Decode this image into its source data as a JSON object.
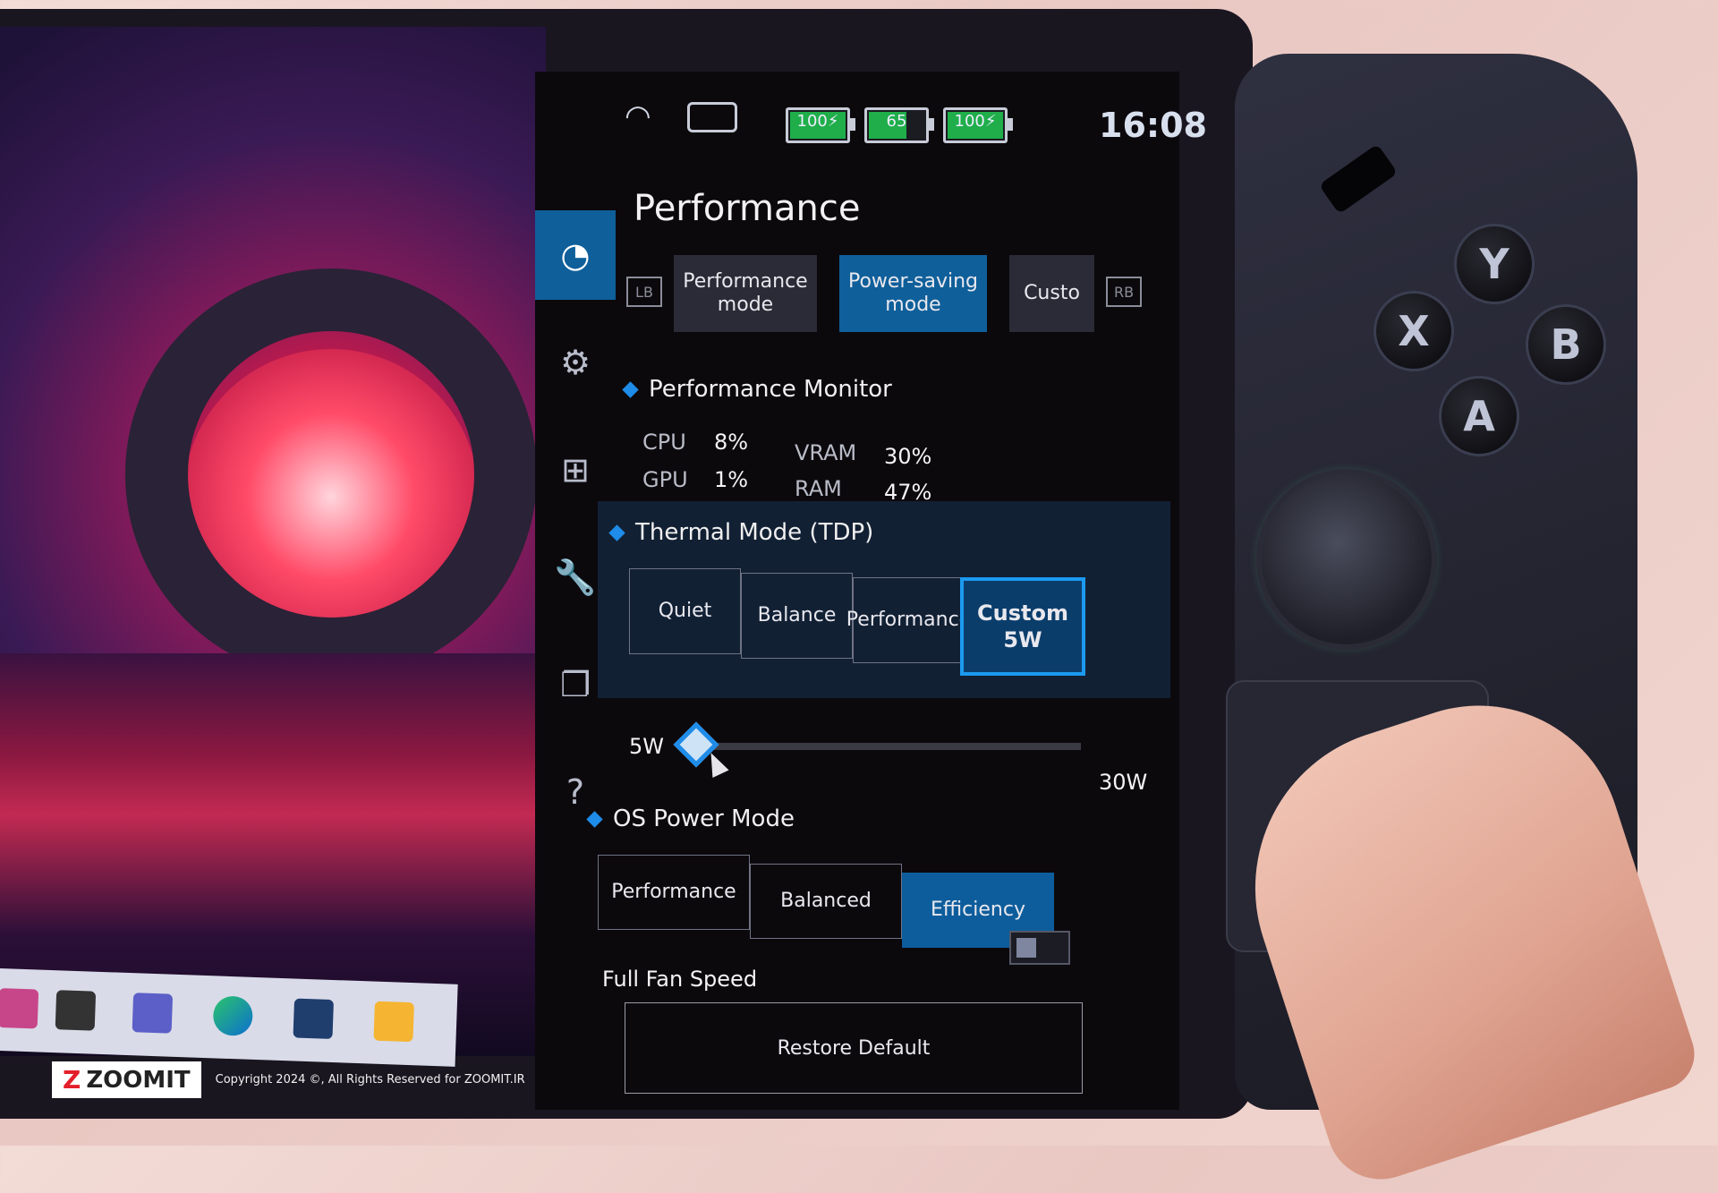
{
  "status_bar": {
    "wifi_icon": "wifi-icon",
    "device_icon": "handheld-device-icon",
    "batteries": [
      {
        "name": "left-controller",
        "label": "100",
        "percent": 100,
        "charging": true
      },
      {
        "name": "device",
        "label": "65",
        "percent": 65,
        "charging": false
      },
      {
        "name": "right-controller",
        "label": "100",
        "percent": 100,
        "charging": true
      }
    ],
    "time": "16:08"
  },
  "nav_rail": {
    "items": [
      {
        "icon": "speedometer-icon",
        "glyph": "◔",
        "active": true
      },
      {
        "icon": "gear-icon",
        "glyph": "⚙",
        "active": false
      },
      {
        "icon": "gamepad-icon",
        "glyph": "⊞",
        "active": false
      },
      {
        "icon": "wrench-icon",
        "glyph": "🔧",
        "active": false
      },
      {
        "icon": "display-icon",
        "glyph": "❐",
        "active": false
      },
      {
        "icon": "help-icon",
        "glyph": "?",
        "active": false
      }
    ]
  },
  "page": {
    "title": "Performance",
    "bumper_left": "LB",
    "bumper_right": "RB",
    "tabs": [
      {
        "label": "Performance mode",
        "active": false
      },
      {
        "label": "Power-saving mode",
        "active": true
      },
      {
        "label": "Custo",
        "active": false
      }
    ]
  },
  "performance_monitor": {
    "heading": "Performance Monitor",
    "metrics": [
      {
        "label": "CPU",
        "value": "8%"
      },
      {
        "label": "GPU",
        "value": "1%"
      },
      {
        "label": "VRAM",
        "value": "30%"
      },
      {
        "label": "RAM",
        "value": "47%"
      }
    ]
  },
  "thermal_mode": {
    "heading": "Thermal Mode (TDP)",
    "options": [
      {
        "label": "Quiet",
        "active": false
      },
      {
        "label": "Balance",
        "active": false
      },
      {
        "label": "Performance",
        "active": false
      },
      {
        "label": "Custom 5W",
        "active": true
      }
    ],
    "slider": {
      "min_label": "5W",
      "max_label": "30W",
      "min": 5,
      "max": 30,
      "value": 5
    }
  },
  "os_power_mode": {
    "heading": "OS Power Mode",
    "options": [
      {
        "label": "Performance",
        "active": false
      },
      {
        "label": "Balanced",
        "active": false
      },
      {
        "label": "Efficiency",
        "active": true
      }
    ]
  },
  "full_fan_speed": {
    "label": "Full Fan Speed",
    "enabled": false
  },
  "restore_default": {
    "label": "Restore Default"
  },
  "controller": {
    "buttons": [
      "Y",
      "X",
      "B",
      "A"
    ]
  },
  "colors": {
    "accent": "#0f5f9a",
    "highlight": "#1c9af0",
    "battery_green": "#1fae4a",
    "panel_bg": "#0c090d"
  },
  "watermark": {
    "brand": "ZOOMIT",
    "brand_mark": "Z",
    "copyright": "Copyright 2024 ©, All Rights Reserved for ZOOMIT.IR"
  }
}
